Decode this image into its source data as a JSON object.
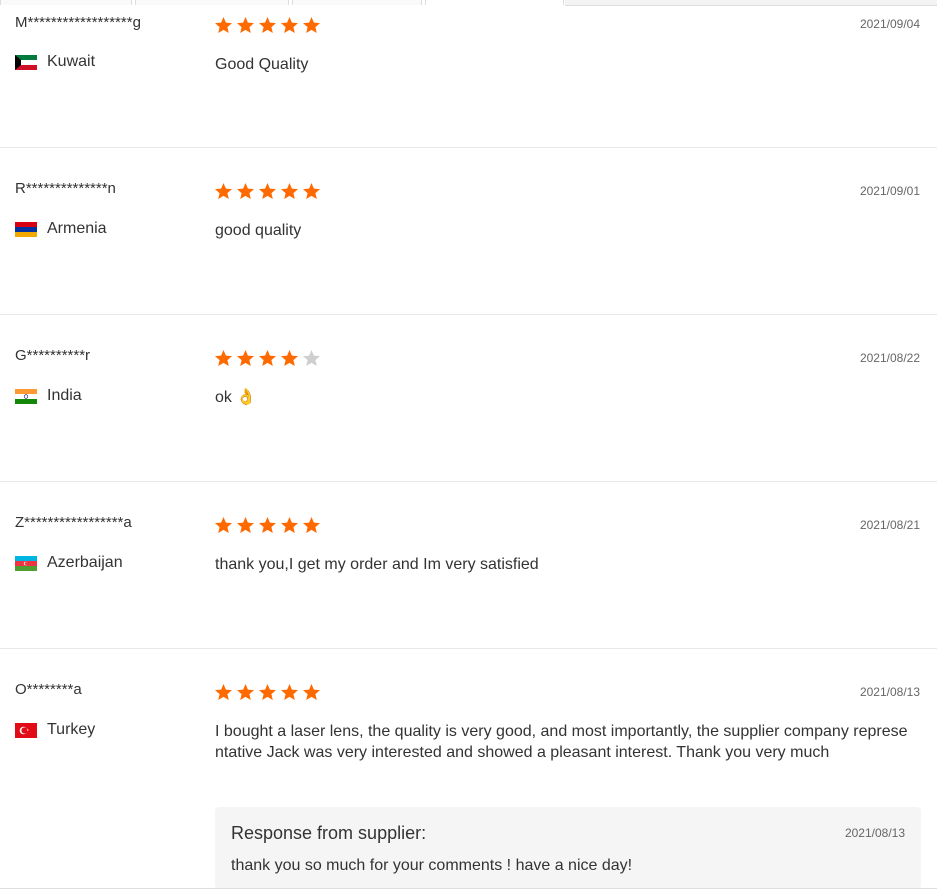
{
  "star_color": "#ff6a00",
  "star_empty_color": "#cfcfcf",
  "reviews": [
    {
      "user": "M******************g",
      "country": "Kuwait",
      "flag": "kuwait-flag",
      "rating": 5,
      "date": "2021/09/04",
      "comment": "Good Quality"
    },
    {
      "user": "R**************n",
      "country": "Armenia",
      "flag": "armenia-flag",
      "rating": 5,
      "date": "2021/09/01",
      "comment": "good quality"
    },
    {
      "user": "G**********r",
      "country": "India",
      "flag": "india-flag",
      "rating": 4,
      "date": "2021/08/22",
      "comment": "ok 👌"
    },
    {
      "user": "Z*****************a",
      "country": "Azerbaijan",
      "flag": "azerbaijan-flag",
      "rating": 5,
      "date": "2021/08/21",
      "comment": "thank you,I get my order and Im very satisfied"
    },
    {
      "user": "O********a",
      "country": "Turkey",
      "flag": "turkey-flag",
      "rating": 5,
      "date": "2021/08/13",
      "comment_lines": [
        "I bought a laser lens, the quality is very good, and most importantly, the supplier company represe",
        "ntative Jack was very interested and showed a pleasant interest. Thank you very much"
      ],
      "response": {
        "title": "Response from supplier:",
        "date": "2021/08/13",
        "text": "thank you so much for your comments ! have a nice day!"
      }
    }
  ]
}
